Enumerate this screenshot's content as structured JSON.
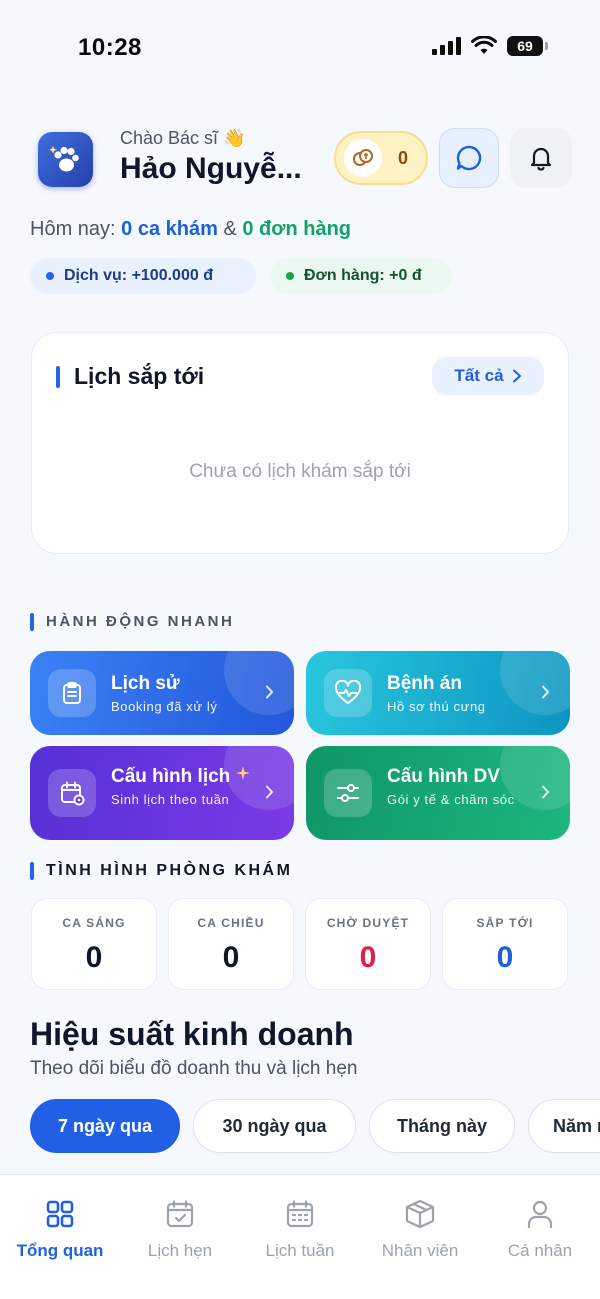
{
  "status_bar": {
    "time": "10:28",
    "battery": "69"
  },
  "header": {
    "greeting": "Chào Bác sĩ 👋",
    "doctor_name": "Hảo Nguyễ...",
    "coins": "0"
  },
  "today": {
    "prefix": "Hôm nay: ",
    "appointments": "0 ca khám",
    "joiner": " & ",
    "orders": "0 đơn hàng"
  },
  "pills": {
    "service": "Dịch vụ: +100.000 đ",
    "order": "Đơn hàng: +0 đ"
  },
  "upcoming": {
    "title": "Lịch sắp tới",
    "see_all": "Tất cả",
    "empty": "Chưa có lịch khám sắp tới"
  },
  "quick_actions": {
    "label": "HÀNH ĐỘNG NHANH",
    "items": [
      {
        "title": "Lịch sử",
        "subtitle": "Booking đã xử lý"
      },
      {
        "title": "Bệnh án",
        "subtitle": "Hồ sơ thú cưng"
      },
      {
        "title": "Cấu hình lịch",
        "subtitle": "Sinh lịch theo tuần"
      },
      {
        "title": "Cấu hình DV",
        "subtitle": "Gói y tế & chăm sóc"
      }
    ]
  },
  "clinic": {
    "label": "TÌNH HÌNH PHÒNG KHÁM",
    "stats": [
      {
        "label": "CA SÁNG",
        "value": "0"
      },
      {
        "label": "CA CHIỀU",
        "value": "0"
      },
      {
        "label": "CHỜ DUYỆT",
        "value": "0"
      },
      {
        "label": "SẮP TỚI",
        "value": "0"
      }
    ]
  },
  "performance": {
    "title": "Hiệu suất kinh doanh",
    "subtitle": "Theo dõi biểu đồ doanh thu và lịch hẹn",
    "ranges": [
      "7 ngày qua",
      "30 ngày qua",
      "Tháng này",
      "Năm nay"
    ]
  },
  "nav": {
    "items": [
      {
        "label": "Tổng quan"
      },
      {
        "label": "Lịch hẹn"
      },
      {
        "label": "Lịch tuần"
      },
      {
        "label": "Nhân viên"
      },
      {
        "label": "Cá nhân"
      }
    ]
  },
  "colors": {
    "accent": "#2160e5",
    "green": "#12a36a",
    "pending_red": "#e11d48",
    "upcoming_blue": "#1d5fe0"
  }
}
